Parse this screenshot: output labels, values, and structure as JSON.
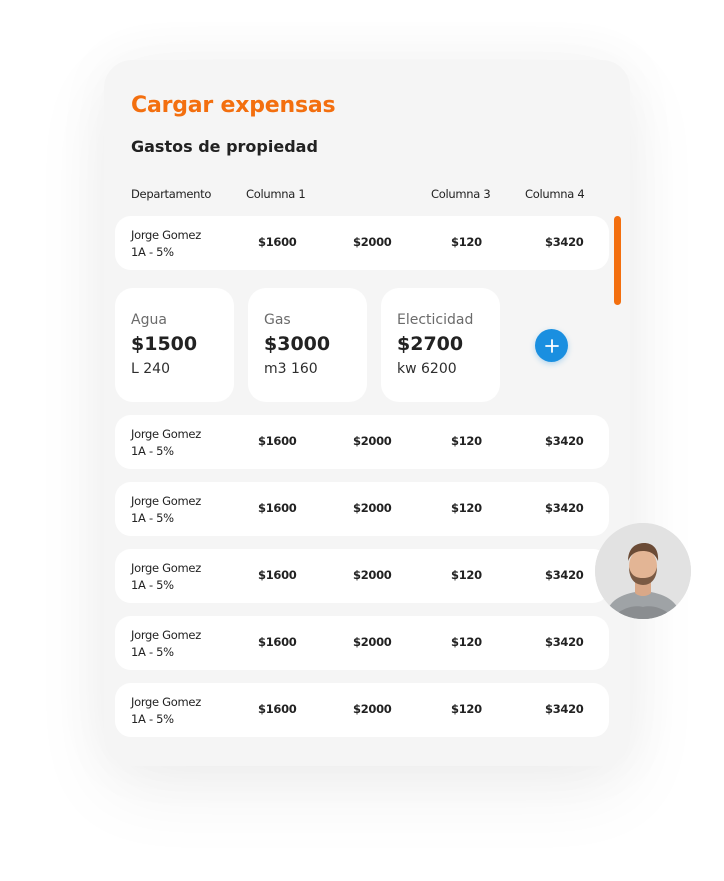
{
  "title": "Cargar expensas",
  "subtitle": "Gastos de propiedad",
  "table": {
    "headers": [
      "Departamento",
      "Columna 1",
      "Columna 3",
      "Columna 4"
    ],
    "rows": [
      {
        "name": "Jorge Gomez",
        "unit": "1A - 5%",
        "values": [
          "$1600",
          "$2000",
          "$120",
          "$3420"
        ]
      },
      {
        "name": "Jorge Gomez",
        "unit": "1A - 5%",
        "values": [
          "$1600",
          "$2000",
          "$120",
          "$3420"
        ]
      },
      {
        "name": "Jorge Gomez",
        "unit": "1A - 5%",
        "values": [
          "$1600",
          "$2000",
          "$120",
          "$3420"
        ]
      },
      {
        "name": "Jorge Gomez",
        "unit": "1A - 5%",
        "values": [
          "$1600",
          "$2000",
          "$120",
          "$3420"
        ]
      },
      {
        "name": "Jorge Gomez",
        "unit": "1A - 5%",
        "values": [
          "$1600",
          "$2000",
          "$120",
          "$3420"
        ]
      },
      {
        "name": "Jorge Gomez",
        "unit": "1A - 5%",
        "values": [
          "$1600",
          "$2000",
          "$120",
          "$3420"
        ]
      }
    ]
  },
  "utilities": [
    {
      "label": "Agua",
      "amount": "$1500",
      "detail": "L 240"
    },
    {
      "label": "Gas",
      "amount": "$3000",
      "detail": "m3 160"
    },
    {
      "label": "Electicidad",
      "amount": "$2700",
      "detail": "kw 6200"
    }
  ],
  "icons": {
    "add": "plus-icon",
    "avatar": "user-avatar"
  },
  "colors": {
    "accent": "#f36f0f",
    "button": "#1a8fe0",
    "panel": "#f5f5f5",
    "card": "#ffffff"
  }
}
